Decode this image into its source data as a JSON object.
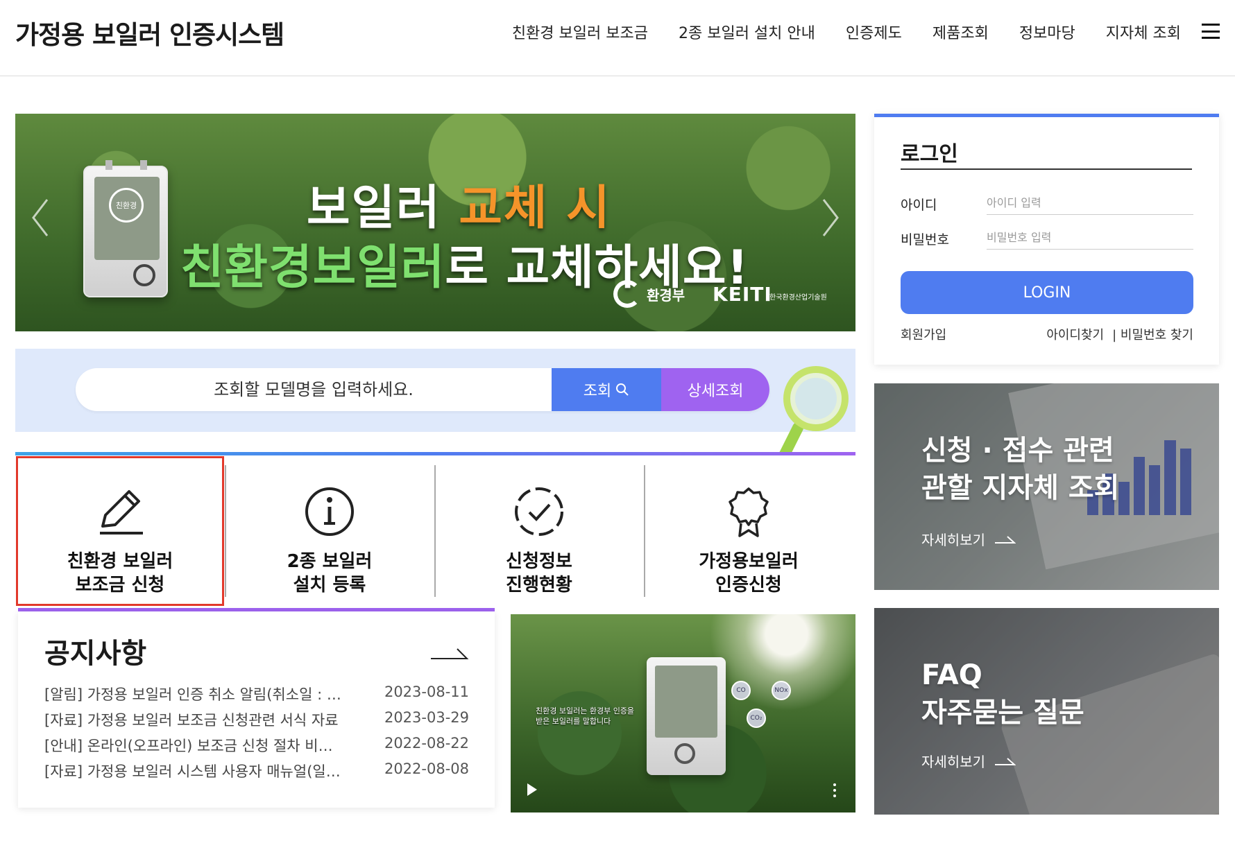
{
  "header": {
    "site_title": "가정용 보일러 인증시스템",
    "nav": [
      "친환경 보일러 보조금",
      "2종 보일러 설치 안내",
      "인증제도",
      "제품조회",
      "정보마당",
      "지자체 조회"
    ]
  },
  "banner": {
    "line1_a": "보일러 ",
    "line1_b": "교체 시",
    "line2_a": "친환경보일러",
    "line2_b": "로 교체하세요!",
    "logo1": "환경부",
    "logo2": "KEITI",
    "logo2_sub": "한국환경산업기술원",
    "boiler_badge": "친환경"
  },
  "search": {
    "placeholder": "조회할 모델명을 입력하세요.",
    "search_label": "조회",
    "detail_label": "상세조회"
  },
  "quick_menu": [
    {
      "label": "친환경 보일러\n보조금 신청",
      "icon": "pencil-icon"
    },
    {
      "label": "2종 보일러\n설치 등록",
      "icon": "info-icon"
    },
    {
      "label": "신청정보\n진행현황",
      "icon": "check-circle-icon"
    },
    {
      "label": "가정용보일러\n인증신청",
      "icon": "award-icon"
    }
  ],
  "notice": {
    "title": "공지사항",
    "items": [
      {
        "title": "[알림] 가정용 보일러 인증 취소 알림(취소일 : …",
        "date": "2023-08-11"
      },
      {
        "title": "[자료] 가정용 보일러 보조금 신청관련 서식 자료",
        "date": "2023-03-29"
      },
      {
        "title": "[안내] 온라인(오프라인) 보조금 신청 절차 비…",
        "date": "2022-08-22"
      },
      {
        "title": "[자료] 가정용 보일러 시스템 사용자 매뉴얼(일…",
        "date": "2022-08-08"
      }
    ]
  },
  "video": {
    "caption": "친환경 보일러는 환경부 인증을\n받은 보일러를 말합니다",
    "bubbles": [
      "CO",
      "NOx",
      "CO₂"
    ]
  },
  "login": {
    "title": "로그인",
    "id_label": "아이디",
    "id_placeholder": "아이디 입력",
    "pw_label": "비밀번호",
    "pw_placeholder": "비밀번호 입력",
    "button": "LOGIN",
    "signup": "회원가입",
    "find_id": "아이디찾기",
    "find_pw": "| 비밀번호 찾기"
  },
  "cards": [
    {
      "title": "신청 · 접수 관련\n관할 지자체 조회",
      "more": "자세히보기"
    },
    {
      "title": "FAQ\n자주묻는 질문",
      "more": "자세히보기"
    }
  ],
  "colors": {
    "primary_blue": "#4f7cf0",
    "purple": "#9f63f0",
    "highlight_red": "#e2392b",
    "banner_orange": "#f5942a",
    "banner_green": "#7fe06f"
  }
}
